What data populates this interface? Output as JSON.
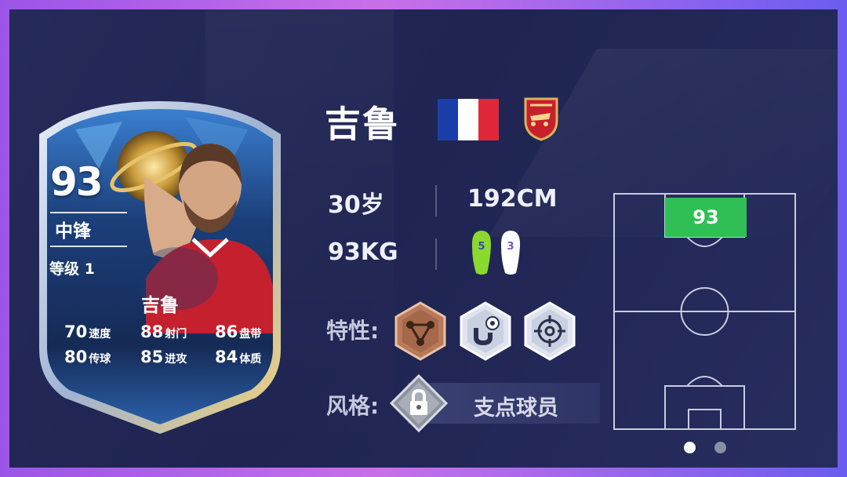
{
  "card": {
    "rating": "93",
    "position": "中锋",
    "level": "等级 1",
    "name": "吉鲁",
    "stats": [
      {
        "value": "70",
        "label": "速度"
      },
      {
        "value": "88",
        "label": "射门"
      },
      {
        "value": "86",
        "label": "盘带"
      },
      {
        "value": "80",
        "label": "传球"
      },
      {
        "value": "85",
        "label": "进攻"
      },
      {
        "value": "84",
        "label": "体质"
      }
    ]
  },
  "player": {
    "name": "吉鲁",
    "nation_flag_colors": [
      "#1b3fa8",
      "#ffffff",
      "#e0283a"
    ],
    "club_crest_icon": "arsenal-crest-icon",
    "age": "30岁",
    "height": "192CM",
    "weight": "93KG",
    "weak_foot": {
      "left": "5",
      "right": "3",
      "left_color": "#8ad92e",
      "right_color": "#ffffff"
    }
  },
  "traits": {
    "label": "特性:",
    "icons": [
      "network-trait-icon",
      "magnet-ball-trait-icon",
      "crosshair-trait-icon"
    ]
  },
  "style": {
    "label": "风格:",
    "value": "支点球员",
    "icon": "lock-icon"
  },
  "pitch": {
    "position_rating": "93",
    "accent_color": "#2fbf55"
  },
  "pagination": {
    "pages": 2,
    "active": 0
  }
}
